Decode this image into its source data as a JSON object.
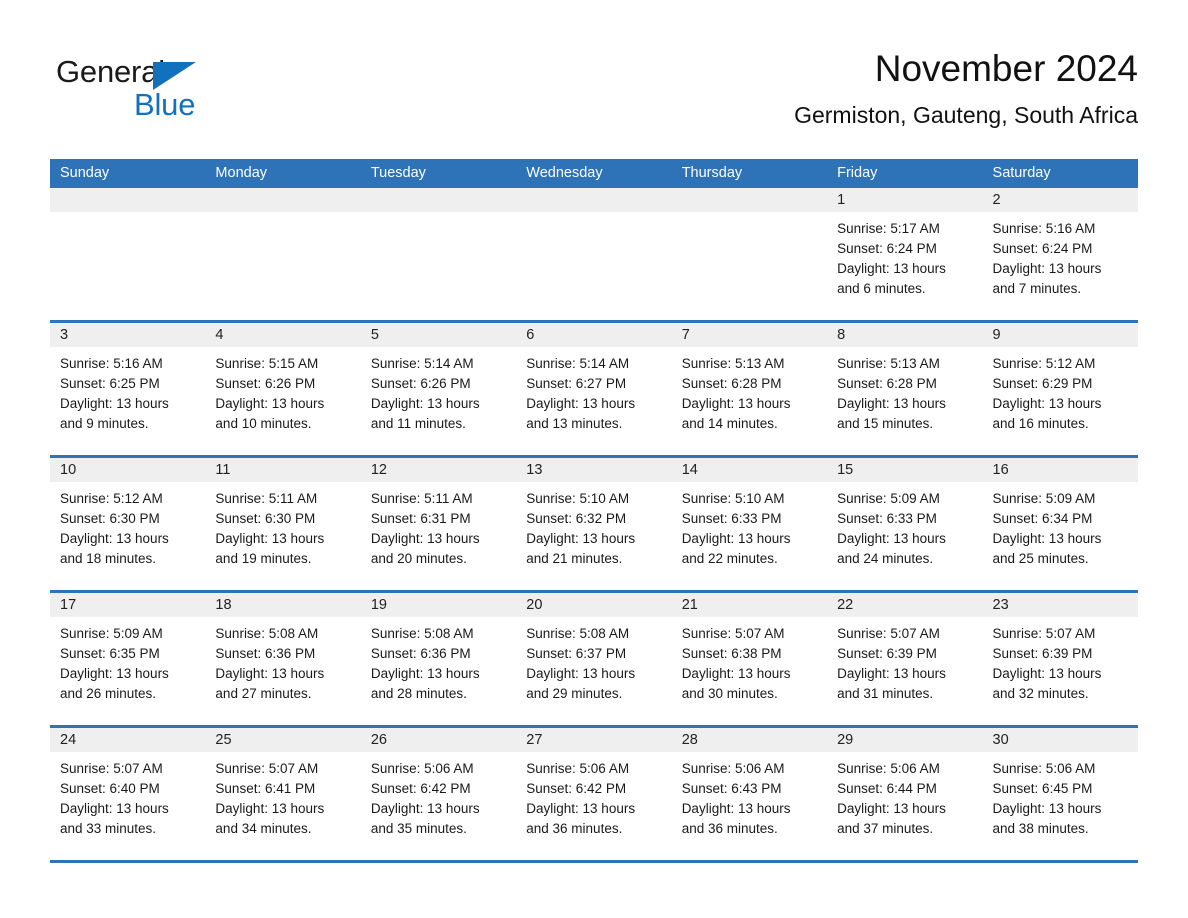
{
  "brand": {
    "name_part1": "General",
    "name_part2": "Blue",
    "logo_icon": "triangle-logo-icon"
  },
  "header": {
    "month_title": "November 2024",
    "location": "Germiston, Gauteng, South Africa"
  },
  "colors": {
    "header_blue": "#2e72b8",
    "brand_blue": "#1271bd",
    "day_band_gray": "#efefef",
    "cell_white": "#ffffff",
    "text": "#1a1a1a"
  },
  "weekdays": [
    "Sunday",
    "Monday",
    "Tuesday",
    "Wednesday",
    "Thursday",
    "Friday",
    "Saturday"
  ],
  "weeks": [
    [
      {
        "day": "",
        "blank": true,
        "sunrise": "",
        "sunset": "",
        "daylight_1": "",
        "daylight_2": ""
      },
      {
        "day": "",
        "blank": true,
        "sunrise": "",
        "sunset": "",
        "daylight_1": "",
        "daylight_2": ""
      },
      {
        "day": "",
        "blank": true,
        "sunrise": "",
        "sunset": "",
        "daylight_1": "",
        "daylight_2": ""
      },
      {
        "day": "",
        "blank": true,
        "sunrise": "",
        "sunset": "",
        "daylight_1": "",
        "daylight_2": ""
      },
      {
        "day": "",
        "blank": true,
        "sunrise": "",
        "sunset": "",
        "daylight_1": "",
        "daylight_2": ""
      },
      {
        "day": "1",
        "sunrise": "Sunrise: 5:17 AM",
        "sunset": "Sunset: 6:24 PM",
        "daylight_1": "Daylight: 13 hours",
        "daylight_2": "and 6 minutes."
      },
      {
        "day": "2",
        "sunrise": "Sunrise: 5:16 AM",
        "sunset": "Sunset: 6:24 PM",
        "daylight_1": "Daylight: 13 hours",
        "daylight_2": "and 7 minutes."
      }
    ],
    [
      {
        "day": "3",
        "sunrise": "Sunrise: 5:16 AM",
        "sunset": "Sunset: 6:25 PM",
        "daylight_1": "Daylight: 13 hours",
        "daylight_2": "and 9 minutes."
      },
      {
        "day": "4",
        "sunrise": "Sunrise: 5:15 AM",
        "sunset": "Sunset: 6:26 PM",
        "daylight_1": "Daylight: 13 hours",
        "daylight_2": "and 10 minutes."
      },
      {
        "day": "5",
        "sunrise": "Sunrise: 5:14 AM",
        "sunset": "Sunset: 6:26 PM",
        "daylight_1": "Daylight: 13 hours",
        "daylight_2": "and 11 minutes."
      },
      {
        "day": "6",
        "sunrise": "Sunrise: 5:14 AM",
        "sunset": "Sunset: 6:27 PM",
        "daylight_1": "Daylight: 13 hours",
        "daylight_2": "and 13 minutes."
      },
      {
        "day": "7",
        "sunrise": "Sunrise: 5:13 AM",
        "sunset": "Sunset: 6:28 PM",
        "daylight_1": "Daylight: 13 hours",
        "daylight_2": "and 14 minutes."
      },
      {
        "day": "8",
        "sunrise": "Sunrise: 5:13 AM",
        "sunset": "Sunset: 6:28 PM",
        "daylight_1": "Daylight: 13 hours",
        "daylight_2": "and 15 minutes."
      },
      {
        "day": "9",
        "sunrise": "Sunrise: 5:12 AM",
        "sunset": "Sunset: 6:29 PM",
        "daylight_1": "Daylight: 13 hours",
        "daylight_2": "and 16 minutes."
      }
    ],
    [
      {
        "day": "10",
        "sunrise": "Sunrise: 5:12 AM",
        "sunset": "Sunset: 6:30 PM",
        "daylight_1": "Daylight: 13 hours",
        "daylight_2": "and 18 minutes."
      },
      {
        "day": "11",
        "sunrise": "Sunrise: 5:11 AM",
        "sunset": "Sunset: 6:30 PM",
        "daylight_1": "Daylight: 13 hours",
        "daylight_2": "and 19 minutes."
      },
      {
        "day": "12",
        "sunrise": "Sunrise: 5:11 AM",
        "sunset": "Sunset: 6:31 PM",
        "daylight_1": "Daylight: 13 hours",
        "daylight_2": "and 20 minutes."
      },
      {
        "day": "13",
        "sunrise": "Sunrise: 5:10 AM",
        "sunset": "Sunset: 6:32 PM",
        "daylight_1": "Daylight: 13 hours",
        "daylight_2": "and 21 minutes."
      },
      {
        "day": "14",
        "sunrise": "Sunrise: 5:10 AM",
        "sunset": "Sunset: 6:33 PM",
        "daylight_1": "Daylight: 13 hours",
        "daylight_2": "and 22 minutes."
      },
      {
        "day": "15",
        "sunrise": "Sunrise: 5:09 AM",
        "sunset": "Sunset: 6:33 PM",
        "daylight_1": "Daylight: 13 hours",
        "daylight_2": "and 24 minutes."
      },
      {
        "day": "16",
        "sunrise": "Sunrise: 5:09 AM",
        "sunset": "Sunset: 6:34 PM",
        "daylight_1": "Daylight: 13 hours",
        "daylight_2": "and 25 minutes."
      }
    ],
    [
      {
        "day": "17",
        "sunrise": "Sunrise: 5:09 AM",
        "sunset": "Sunset: 6:35 PM",
        "daylight_1": "Daylight: 13 hours",
        "daylight_2": "and 26 minutes."
      },
      {
        "day": "18",
        "sunrise": "Sunrise: 5:08 AM",
        "sunset": "Sunset: 6:36 PM",
        "daylight_1": "Daylight: 13 hours",
        "daylight_2": "and 27 minutes."
      },
      {
        "day": "19",
        "sunrise": "Sunrise: 5:08 AM",
        "sunset": "Sunset: 6:36 PM",
        "daylight_1": "Daylight: 13 hours",
        "daylight_2": "and 28 minutes."
      },
      {
        "day": "20",
        "sunrise": "Sunrise: 5:08 AM",
        "sunset": "Sunset: 6:37 PM",
        "daylight_1": "Daylight: 13 hours",
        "daylight_2": "and 29 minutes."
      },
      {
        "day": "21",
        "sunrise": "Sunrise: 5:07 AM",
        "sunset": "Sunset: 6:38 PM",
        "daylight_1": "Daylight: 13 hours",
        "daylight_2": "and 30 minutes."
      },
      {
        "day": "22",
        "sunrise": "Sunrise: 5:07 AM",
        "sunset": "Sunset: 6:39 PM",
        "daylight_1": "Daylight: 13 hours",
        "daylight_2": "and 31 minutes."
      },
      {
        "day": "23",
        "sunrise": "Sunrise: 5:07 AM",
        "sunset": "Sunset: 6:39 PM",
        "daylight_1": "Daylight: 13 hours",
        "daylight_2": "and 32 minutes."
      }
    ],
    [
      {
        "day": "24",
        "sunrise": "Sunrise: 5:07 AM",
        "sunset": "Sunset: 6:40 PM",
        "daylight_1": "Daylight: 13 hours",
        "daylight_2": "and 33 minutes."
      },
      {
        "day": "25",
        "sunrise": "Sunrise: 5:07 AM",
        "sunset": "Sunset: 6:41 PM",
        "daylight_1": "Daylight: 13 hours",
        "daylight_2": "and 34 minutes."
      },
      {
        "day": "26",
        "sunrise": "Sunrise: 5:06 AM",
        "sunset": "Sunset: 6:42 PM",
        "daylight_1": "Daylight: 13 hours",
        "daylight_2": "and 35 minutes."
      },
      {
        "day": "27",
        "sunrise": "Sunrise: 5:06 AM",
        "sunset": "Sunset: 6:42 PM",
        "daylight_1": "Daylight: 13 hours",
        "daylight_2": "and 36 minutes."
      },
      {
        "day": "28",
        "sunrise": "Sunrise: 5:06 AM",
        "sunset": "Sunset: 6:43 PM",
        "daylight_1": "Daylight: 13 hours",
        "daylight_2": "and 36 minutes."
      },
      {
        "day": "29",
        "sunrise": "Sunrise: 5:06 AM",
        "sunset": "Sunset: 6:44 PM",
        "daylight_1": "Daylight: 13 hours",
        "daylight_2": "and 37 minutes."
      },
      {
        "day": "30",
        "sunrise": "Sunrise: 5:06 AM",
        "sunset": "Sunset: 6:45 PM",
        "daylight_1": "Daylight: 13 hours",
        "daylight_2": "and 38 minutes."
      }
    ]
  ]
}
